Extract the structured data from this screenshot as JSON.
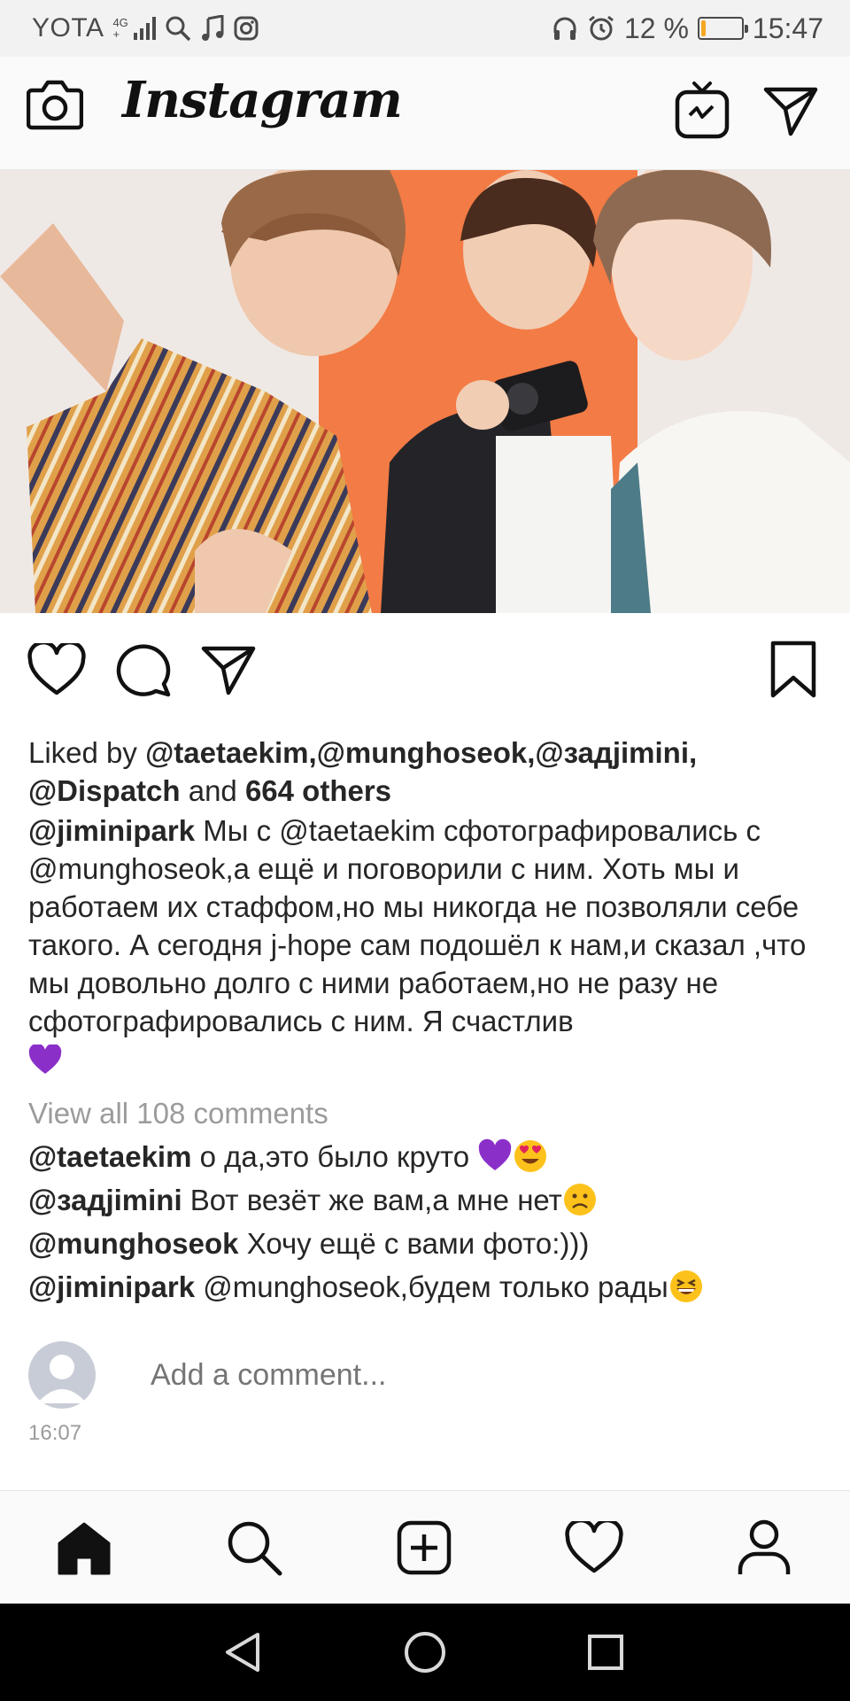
{
  "status_bar": {
    "carrier": "YOTA",
    "network_top": "4G",
    "network_bottom": "+",
    "battery_percent": "12 %",
    "battery_level": 0.12,
    "time": "15:47",
    "icons": [
      "signal-icon",
      "search-icon",
      "music-icon",
      "instagram-icon",
      "headphones-icon",
      "alarm-icon",
      "battery-icon"
    ]
  },
  "header": {
    "logo_text": "Instagram",
    "icons": [
      "camera-icon",
      "igtv-icon",
      "direct-message-icon"
    ]
  },
  "post": {
    "photo_icon": "photo-image",
    "likes_prefix": "Liked by ",
    "liked_users": "@taetaekim,@munghoseok,@задjimini,",
    "liked_user_2": "@Dispatch",
    "likes_and": " and ",
    "likes_others": "664 others",
    "caption_author": "@jiminipark",
    "caption_text": " Мы с @taetaekim сфотографировались с @munghoseok,а ещё и поговорили с ним. Хоть мы и работаем их стаффом,но мы никогда не позволяли себе такого. А сегодня j-hope сам подошёл к нам,и сказал ,что мы довольно долго с ними работаем,но не разу не сфотографировались с ним. Я счастлив",
    "view_all_comments": "View all 108 comments",
    "comments": [
      {
        "author": "@taetaekim",
        "text": " о да,это было круто "
      },
      {
        "author": "@задjimini",
        "text": " Вот везёт же вам,а мне нет"
      },
      {
        "author": "@munghoseok",
        "text": " Хочу ещё с вами фото:)))"
      },
      {
        "author": "@jiminipark",
        "text": " @munghoseok,будем только рады"
      }
    ],
    "add_comment_placeholder": "Add a comment...",
    "timestamp": "16:07"
  },
  "colors": {
    "purple_heart": "#8b2fc9",
    "emoji_yellow": "#fcc21b",
    "text": "#262626",
    "muted": "#9b9b9b",
    "battery": "#f5a623"
  },
  "bottom_nav": {
    "items": [
      "home-icon",
      "search-icon",
      "new-post-icon",
      "activity-heart-icon",
      "profile-icon"
    ]
  },
  "system_nav": {
    "items": [
      "back-icon",
      "home-circle-icon",
      "recents-icon"
    ]
  }
}
